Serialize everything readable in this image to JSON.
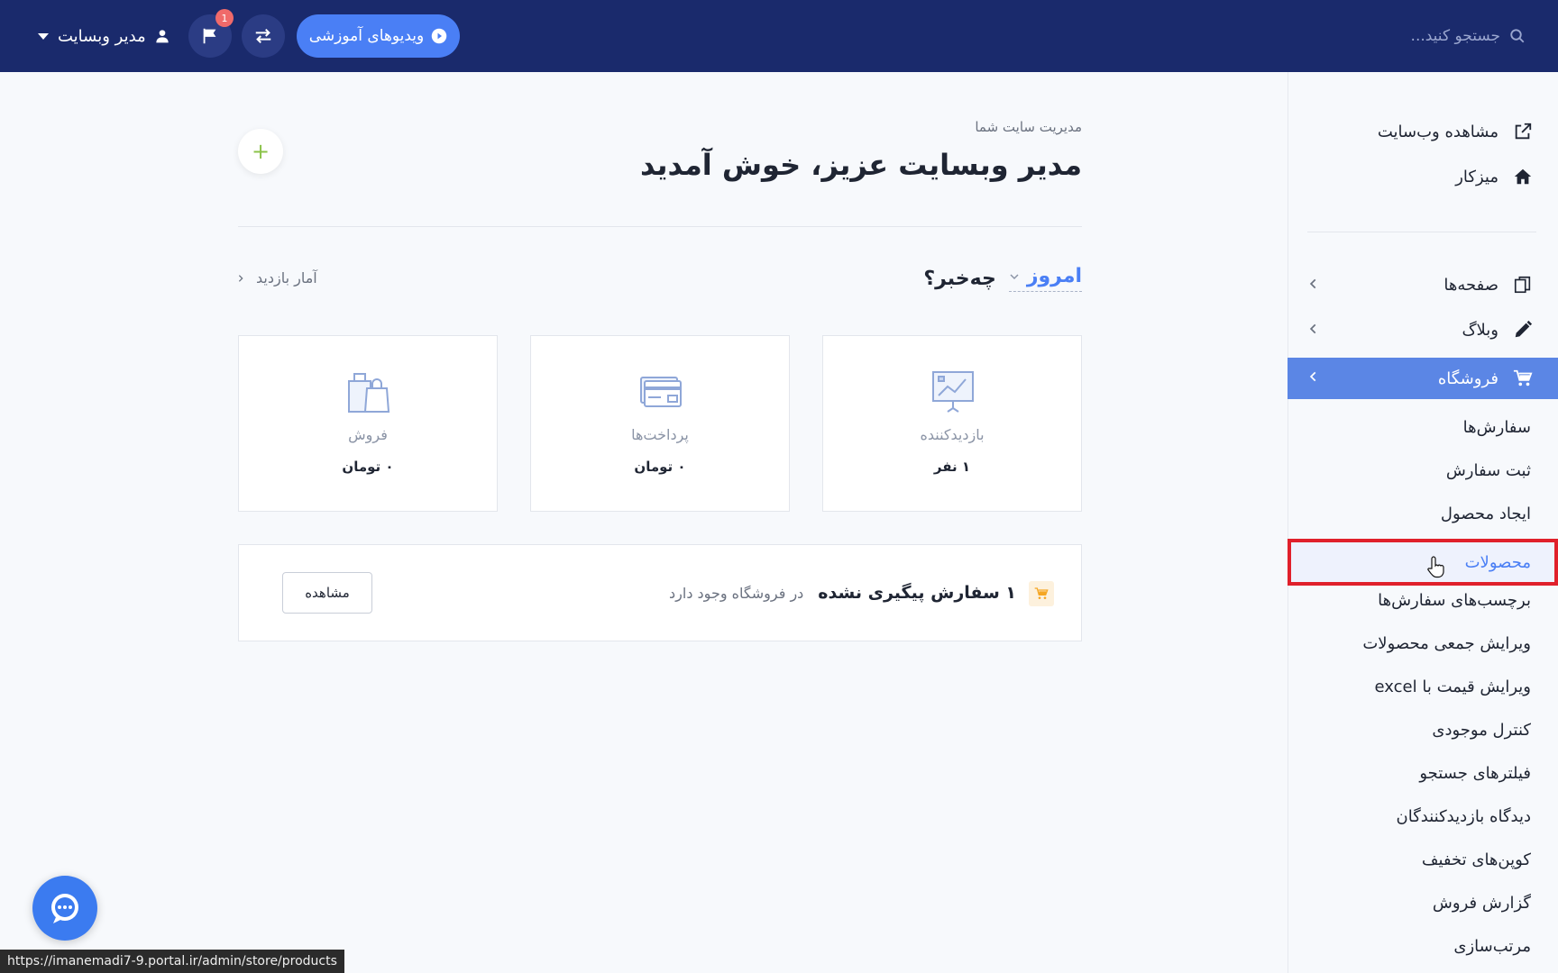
{
  "topbar": {
    "search_placeholder": "جستجو کنید...",
    "user_label": "مدیر وبسایت",
    "notification_count": "1",
    "video_button": "ویدیوهای آموزشی"
  },
  "sidebar": {
    "top_items": [
      {
        "label": "مشاهده وب‌سایت"
      },
      {
        "label": "میزکار"
      }
    ],
    "sections": [
      {
        "label": "صفحه‌ها"
      },
      {
        "label": "وبلاگ"
      },
      {
        "label": "فروشگاه"
      }
    ],
    "store_sub_items": [
      "سفارش‌ها",
      "ثبت سفارش",
      "ایجاد محصول",
      "محصولات",
      "برچسب‌های سفارش‌ها",
      "ویرایش جمعی محصولات",
      "ویرایش قیمت با excel",
      "کنترل موجودی",
      "فیلترهای جستجو",
      "دیدگاه بازدیدکنندگان",
      "کوپن‌های تخفیف",
      "گزارش فروش",
      "مرتب‌سازی"
    ]
  },
  "main": {
    "subtitle": "مدیریت سایت شما",
    "title": "مدیر وبسایت عزیز، خوش آمدید",
    "add_button": "+",
    "news_title": "چه‌خبر؟",
    "period": "امروز",
    "stats_link": "آمار بازدید",
    "cards": [
      {
        "label": "بازدیدکننده",
        "value": "۱ نفر"
      },
      {
        "label": "پرداخت‌ها",
        "value": "۰ تومان"
      },
      {
        "label": "فروش",
        "value": "۰ تومان"
      }
    ],
    "order": {
      "text": "۱ سفارش پیگیری نشده",
      "sub": "در فروشگاه وجود دارد",
      "button": "مشاهده"
    }
  },
  "statusbar_url": "https://imanemadi7-9.portal.ir/admin/store/products",
  "colors": {
    "topbar": "#1a2a6c",
    "accent": "#4a7ff5",
    "sidebar_active": "#5b86e5",
    "highlight": "#e0202b"
  }
}
